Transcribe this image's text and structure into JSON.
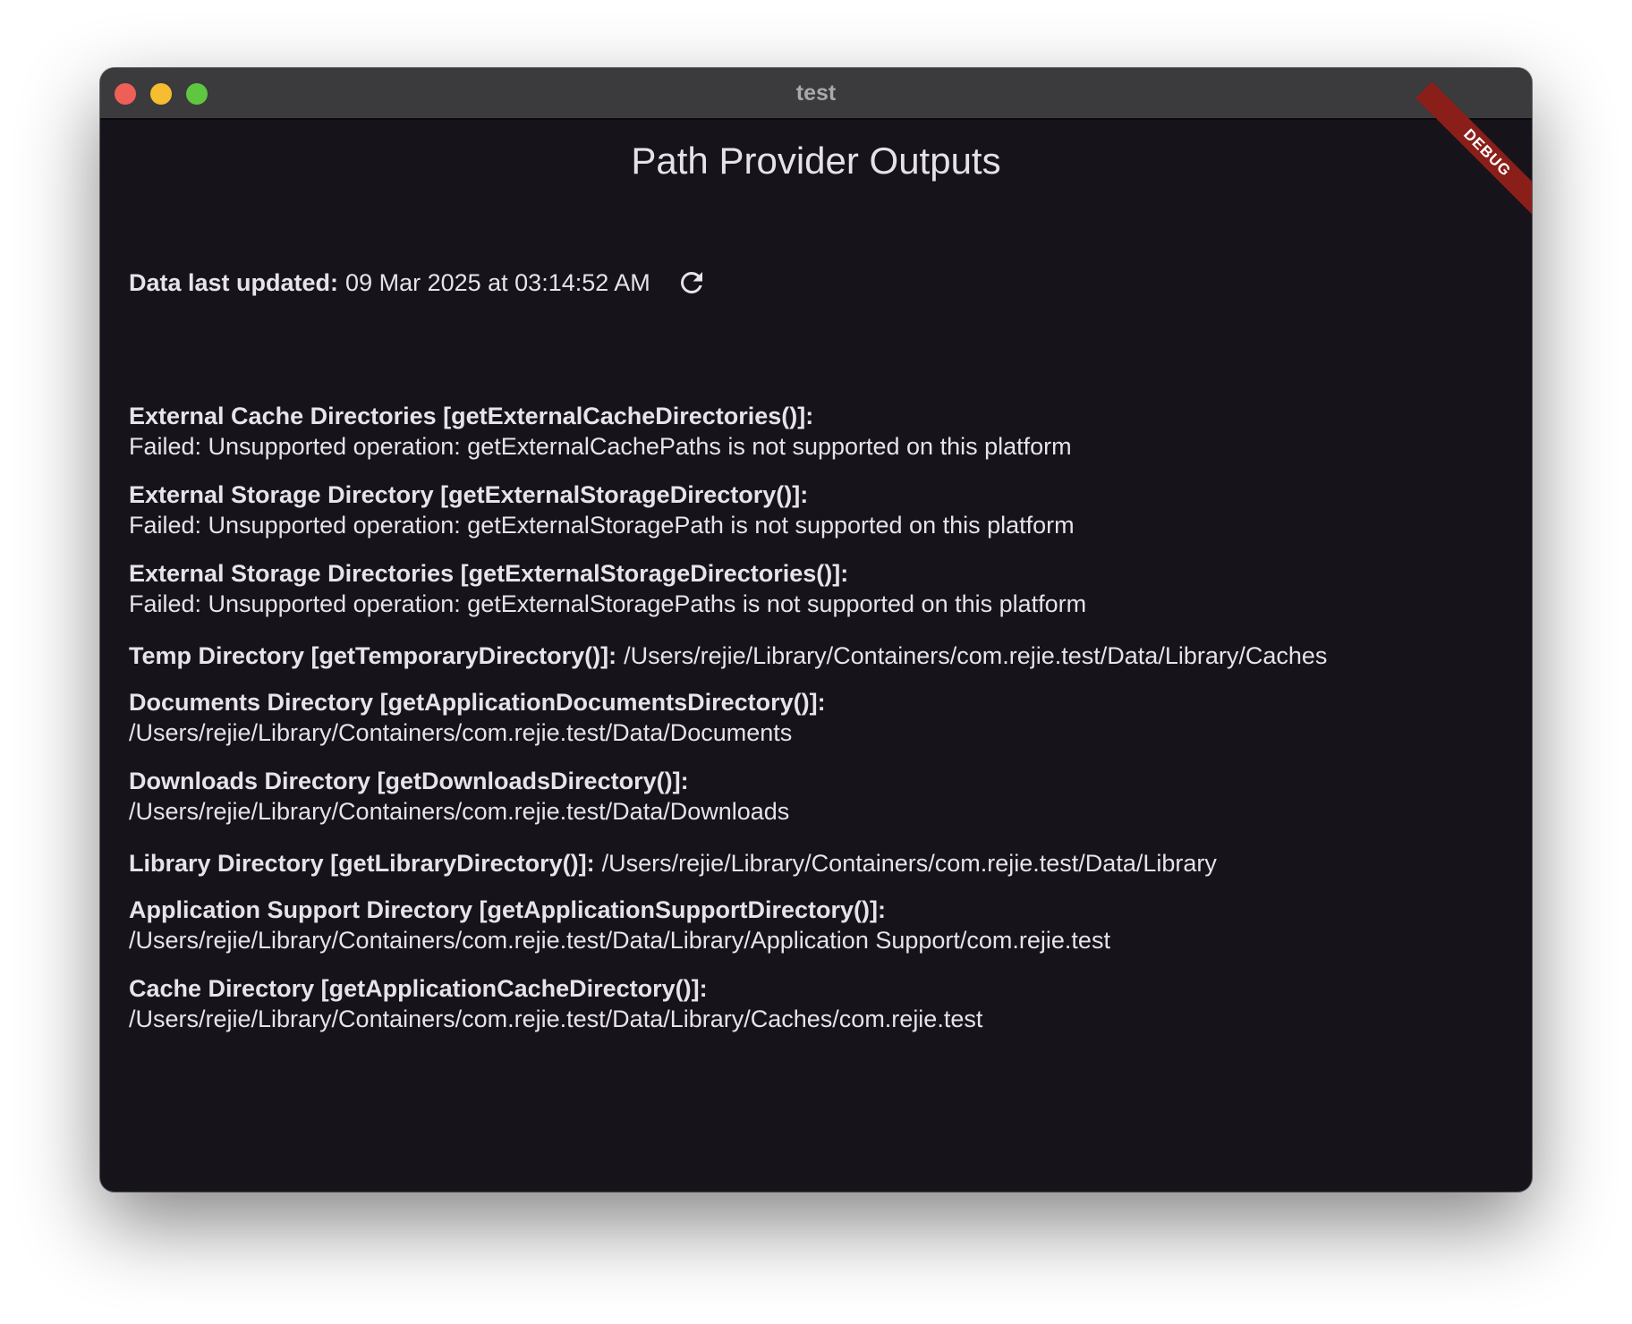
{
  "window": {
    "title": "test"
  },
  "page": {
    "title": "Path Provider Outputs",
    "debug_banner": "DEBUG"
  },
  "updated": {
    "label": "Data last updated:",
    "value": "09 Mar 2025 at 03:14:52 AM",
    "refresh_icon": "refresh-icon"
  },
  "entries": [
    {
      "label": "External Cache Directories [getExternalCacheDirectories()]:",
      "value": "Failed: Unsupported operation: getExternalCachePaths is not supported on this platform"
    },
    {
      "label": "External Storage Directory [getExternalStorageDirectory()]:",
      "value": "Failed: Unsupported operation: getExternalStoragePath is not supported on this platform"
    },
    {
      "label": "External Storage Directories [getExternalStorageDirectories()]:",
      "value": "Failed: Unsupported operation: getExternalStoragePaths is not supported on this platform"
    },
    {
      "label": "Temp Directory [getTemporaryDirectory()]:",
      "value": "/Users/rejie/Library/Containers/com.rejie.test/Data/Library/Caches"
    },
    {
      "label": "Documents Directory [getApplicationDocumentsDirectory()]:",
      "value": "/Users/rejie/Library/Containers/com.rejie.test/Data/Documents"
    },
    {
      "label": "Downloads Directory [getDownloadsDirectory()]:",
      "value": "/Users/rejie/Library/Containers/com.rejie.test/Data/Downloads"
    },
    {
      "label": "Library Directory [getLibraryDirectory()]:",
      "value": "/Users/rejie/Library/Containers/com.rejie.test/Data/Library"
    },
    {
      "label": "Application Support Directory [getApplicationSupportDirectory()]:",
      "value": "/Users/rejie/Library/Containers/com.rejie.test/Data/Library/Application Support/com.rejie.test"
    },
    {
      "label": "Cache Directory [getApplicationCacheDirectory()]:",
      "value": "/Users/rejie/Library/Containers/com.rejie.test/Data/Library/Caches/com.rejie.test"
    }
  ],
  "colors": {
    "window_background": "#16131b",
    "titlebar": "#3b3a3d",
    "text": "#e6e3ea",
    "debug_banner": "#8a1f1a",
    "close": "#ee5f57",
    "minimize": "#f5bd2f",
    "zoom": "#5fc640"
  }
}
